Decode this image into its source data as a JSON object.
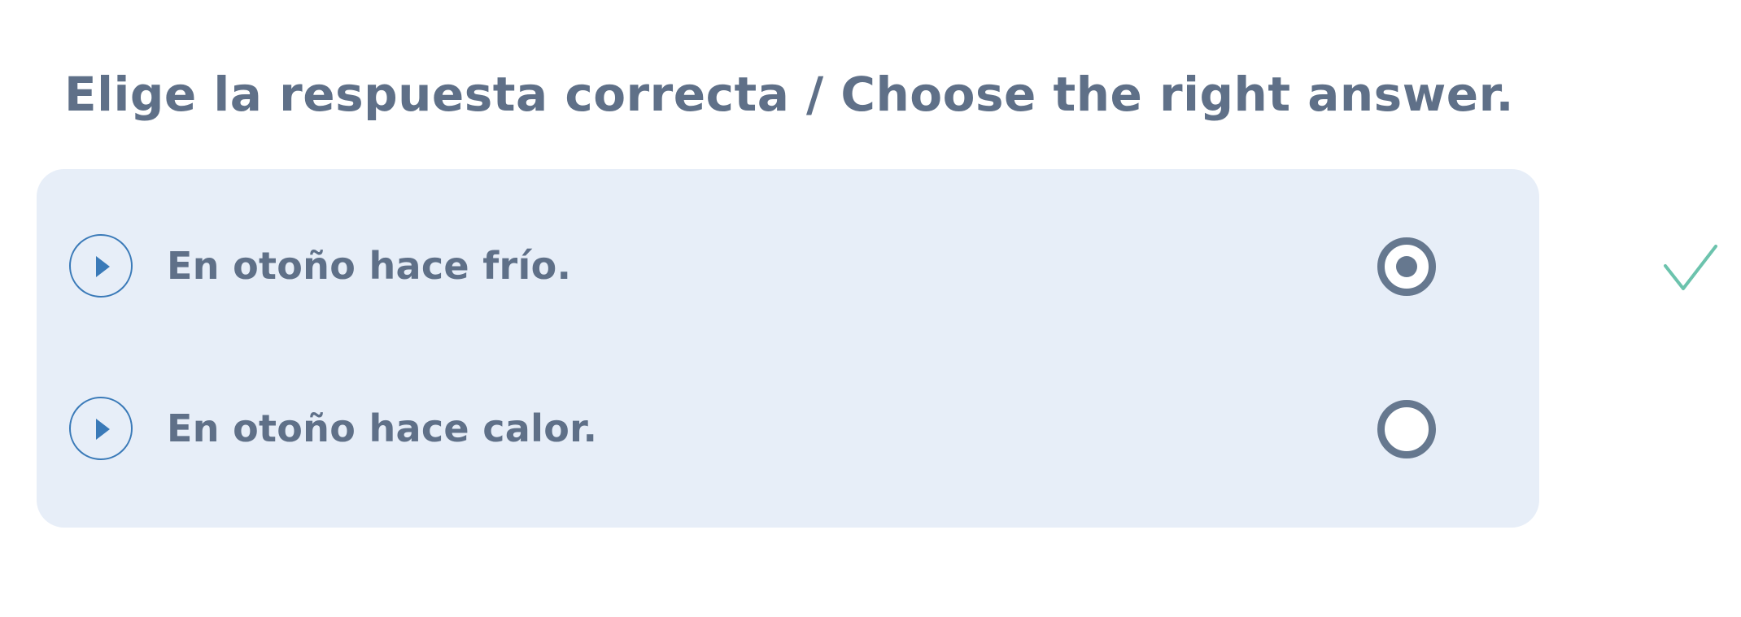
{
  "question": {
    "title": "Elige la respuesta correcta / Choose the right answer."
  },
  "options": [
    {
      "text": "En otoño hace frío.",
      "selected": true,
      "audio_icon": "play-icon"
    },
    {
      "text": "En otoño hace calor.",
      "selected": false,
      "audio_icon": "play-icon"
    }
  ],
  "feedback": {
    "icon": "checkmark-icon",
    "color": "#6cc3ad"
  },
  "colors": {
    "text": "#5f7088",
    "card_background": "#e7eef8",
    "audio_accent": "#3a7ab8",
    "radio": "#66788f"
  }
}
